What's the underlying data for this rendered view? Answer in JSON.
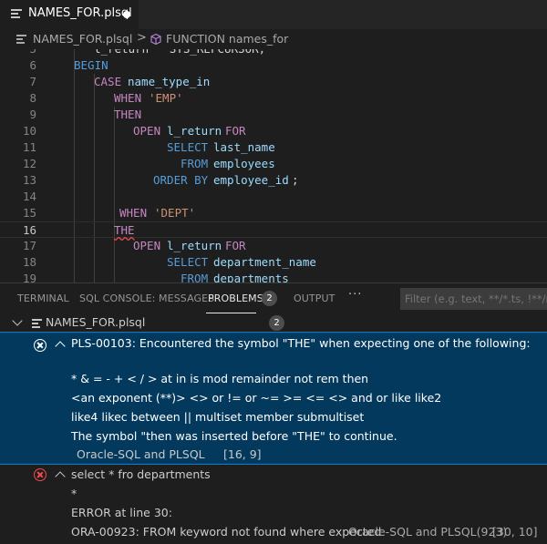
{
  "tab": {
    "title": "NAMES_FOR.plsql"
  },
  "breadcrumb": {
    "file": "NAMES_FOR.plsql",
    "separator": ">",
    "function": "FUNCTION names_for"
  },
  "editor": {
    "lines": [
      {
        "n": "5",
        "partial_text": "l_return   SYS_REFCURSOR;"
      },
      {
        "n": "6",
        "kw": "BEGIN"
      },
      {
        "n": "7",
        "kw": "CASE",
        "id": "name_type_in"
      },
      {
        "n": "8",
        "kw": "WHEN",
        "str": "'EMP'"
      },
      {
        "n": "9",
        "kw": "THEN"
      },
      {
        "n": "10",
        "kw": "OPEN",
        "id": "l_return",
        "kw2": "FOR"
      },
      {
        "n": "11",
        "kw": "SELECT",
        "id": "last_name"
      },
      {
        "n": "12",
        "kw": "FROM",
        "id": "employees"
      },
      {
        "n": "13",
        "kw": "ORDER BY",
        "id": "employee_id",
        "tail": ";"
      },
      {
        "n": "14"
      },
      {
        "n": "15",
        "kw": "WHEN",
        "str": "'DEPT'"
      },
      {
        "n": "16",
        "err": "THE"
      },
      {
        "n": "17",
        "kw": "OPEN",
        "id": "l_return",
        "kw2": "FOR"
      },
      {
        "n": "18",
        "kw": "SELECT",
        "id": "department_name"
      },
      {
        "n": "19",
        "kw": "FROM",
        "id": "departments"
      }
    ]
  },
  "panel": {
    "tabs": [
      "TERMINAL",
      "SQL CONSOLE: MESSAGES",
      "PROBLEMS",
      "OUTPUT"
    ],
    "problems_count": "2",
    "more": "···",
    "filter_placeholder": "Filter (e.g. text, **/*.ts, !**/node_modules/**)"
  },
  "problems": {
    "file": "NAMES_FOR.plsql",
    "count": "2",
    "items": [
      {
        "lines": [
          "PLS-00103: Encountered the symbol \"THE\" when expecting one of the following:",
          "",
          "* & = - + < / > at in is mod remainder not rem then",
          "<an exponent (**)> <> or != or ~= >= <= <> and or like like2",
          "like4 likec between || multiset member submultiset",
          "The symbol \"then was inserted before \"THE\" to continue."
        ],
        "source": "Oracle-SQL and PLSQL",
        "position": "[16, 9]"
      },
      {
        "lines": [
          "select * fro departments",
          "*",
          "ERROR at line 30:",
          "ORA-00923: FROM keyword not found where expected"
        ],
        "source": "Oracle-SQL and PLSQL(923)",
        "position": "[30, 10]"
      }
    ]
  }
}
